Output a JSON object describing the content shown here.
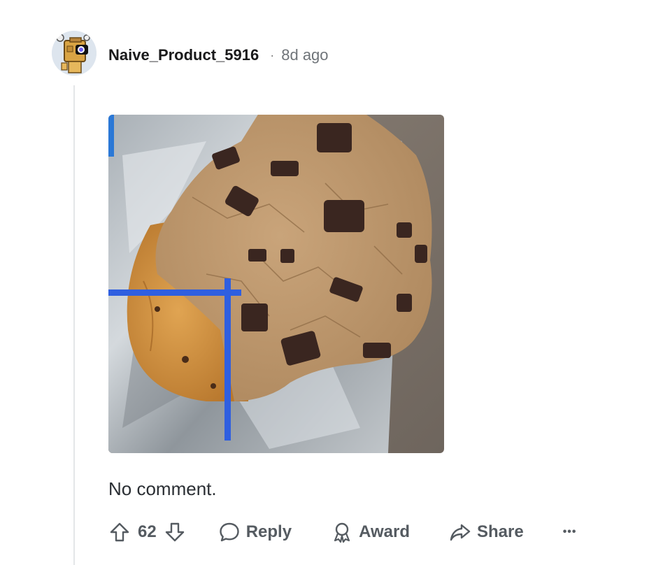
{
  "comment": {
    "author": "Naive_Product_5916",
    "separator": "·",
    "time": "8d ago",
    "text": "No comment.",
    "score": "62"
  },
  "actions": {
    "reply_label": "Reply",
    "award_label": "Award",
    "share_label": "Share",
    "more_label": "•••"
  },
  "icons": {
    "upvote": "arrow-up-outline-icon",
    "downvote": "arrow-down-outline-icon",
    "reply": "speech-bubble-icon",
    "award": "award-ribbon-icon",
    "share": "share-arrow-icon",
    "more": "ellipsis-icon"
  },
  "colors": {
    "text_primary": "#1a1a1b",
    "text_secondary": "#555b61",
    "thread_line": "#e4e6e8",
    "annotation_blue": "#2f5fe0"
  }
}
